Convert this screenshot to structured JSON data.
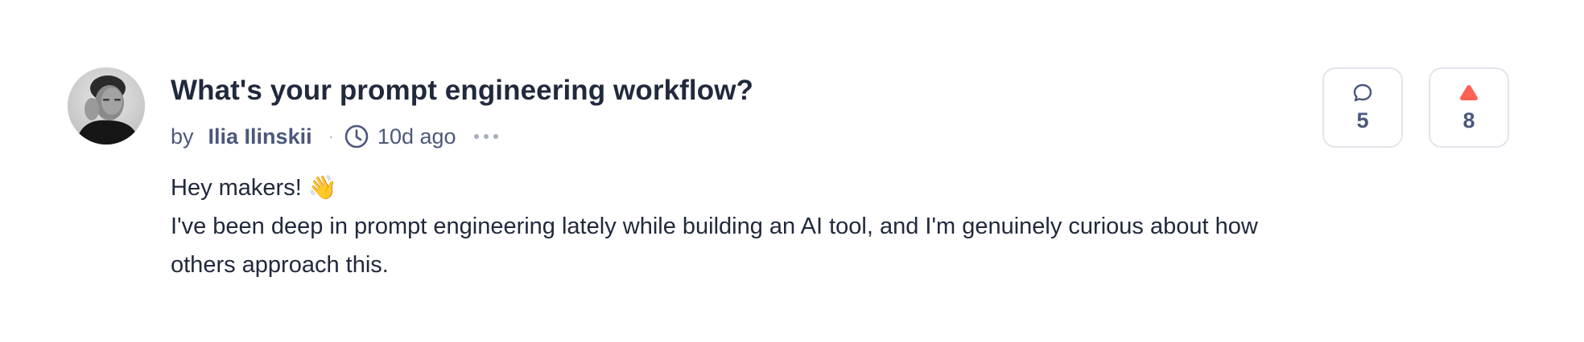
{
  "post": {
    "title": "What's your prompt engineering workflow?",
    "by_label": "by",
    "author": "Ilia Ilinskii",
    "separator": "·",
    "time_ago": "10d ago",
    "body_greeting": "Hey makers! 👋",
    "body_text": "I've been deep in prompt engineering lately while building an AI tool, and I'm genuinely curious about how others approach this."
  },
  "actions": {
    "comments_count": "5",
    "upvotes_count": "8"
  },
  "icons": {
    "comment": "comment-bubble-icon",
    "upvote": "upvote-triangle-icon",
    "clock": "clock-icon",
    "more": "more-dots-icon"
  },
  "colors": {
    "title": "#21293c",
    "meta": "#4b587c",
    "border": "#e2e5eb",
    "upvote": "#ff6154"
  }
}
